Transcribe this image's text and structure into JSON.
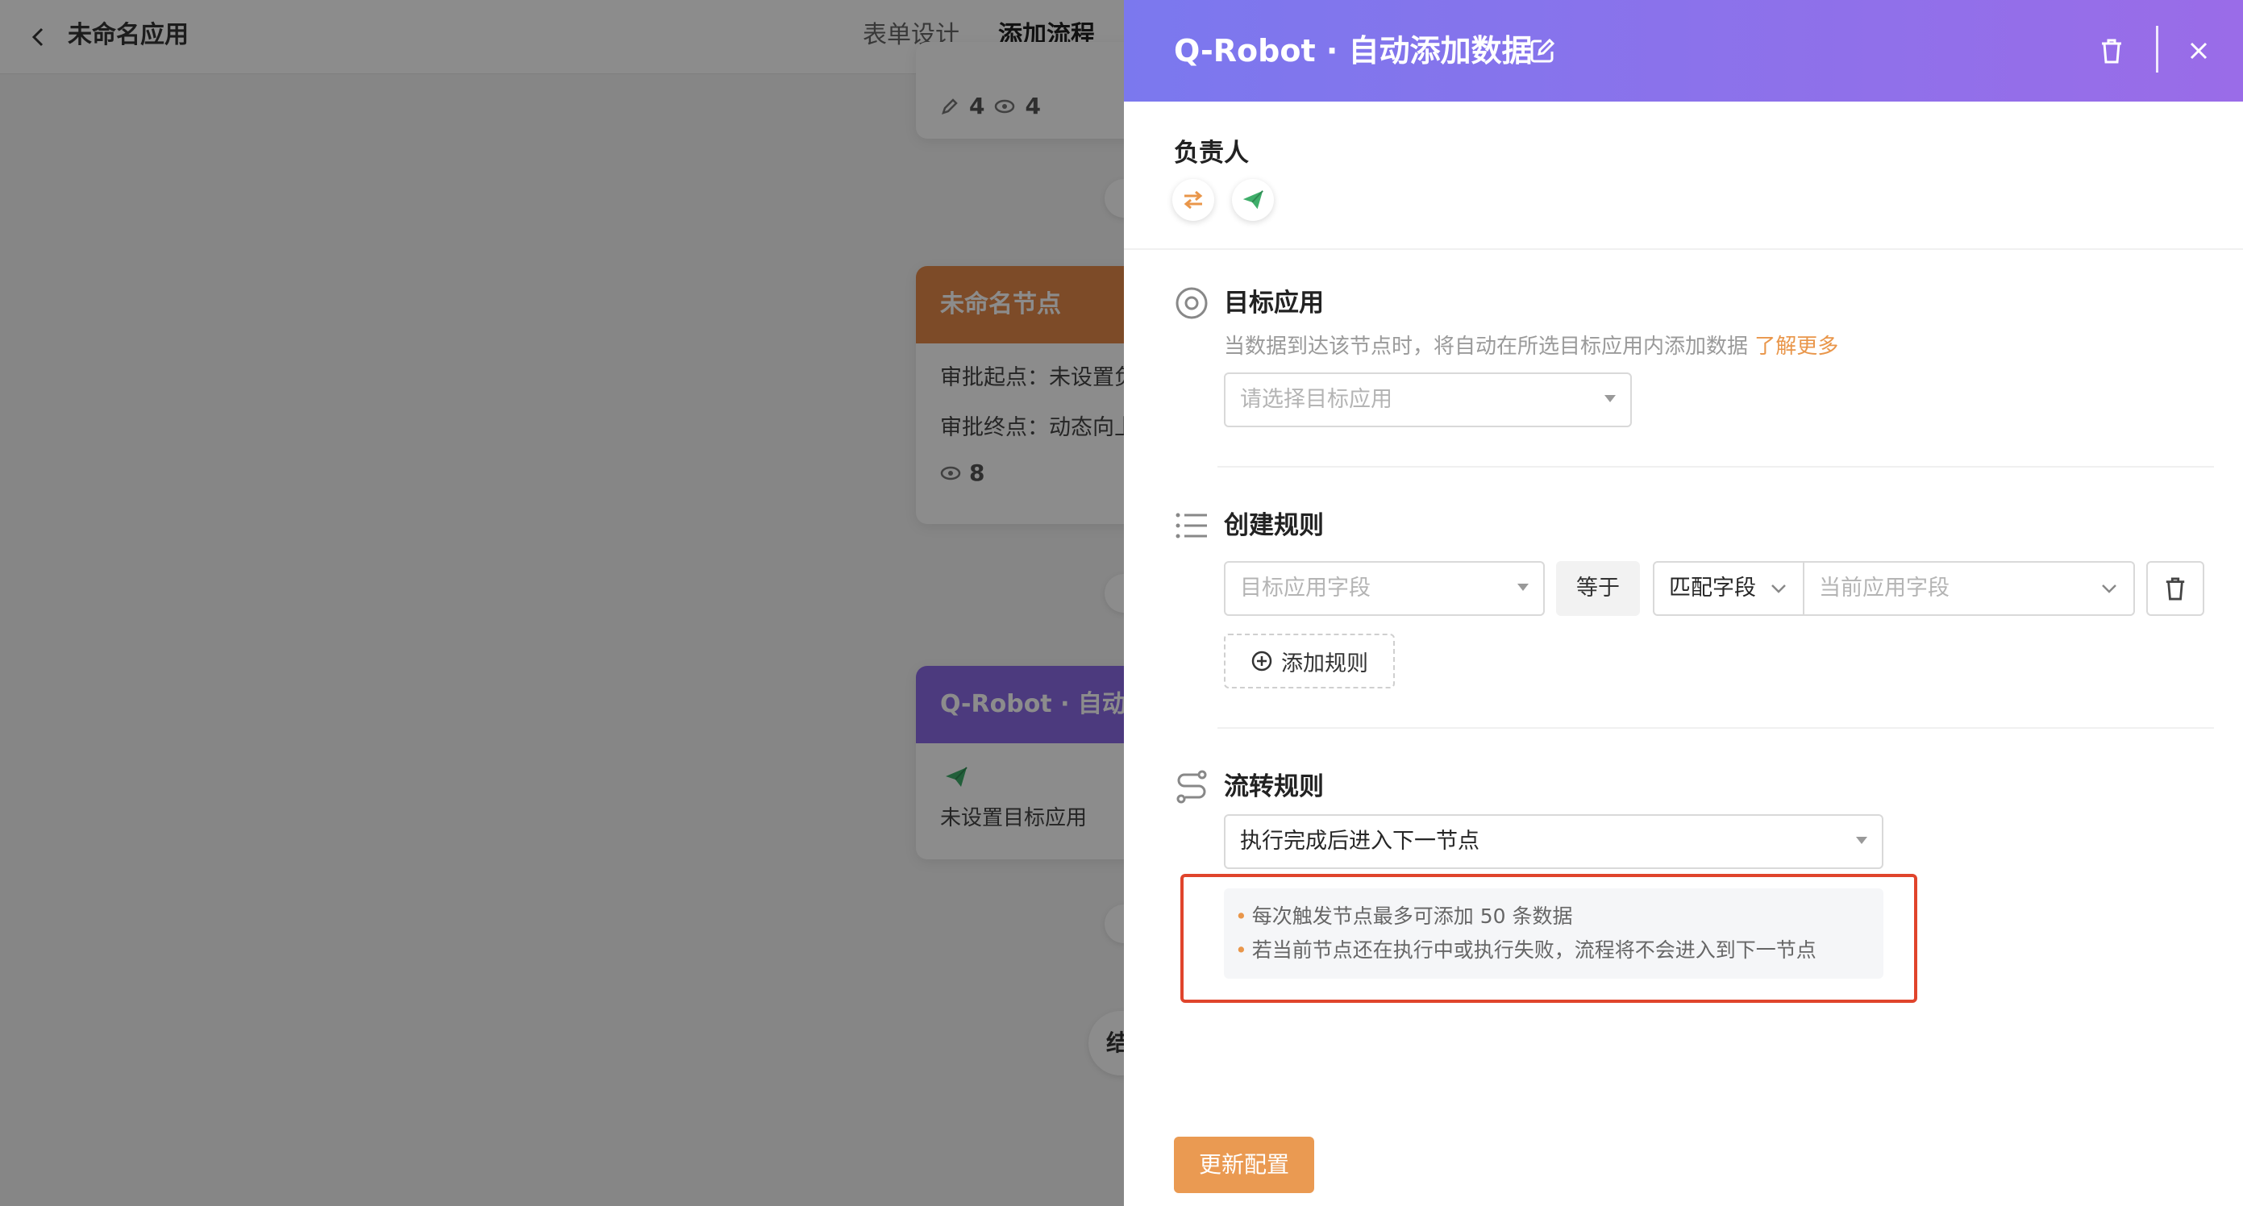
{
  "app": {
    "title": "未命名应用",
    "tabs": [
      {
        "label": "表单设计",
        "active": false
      },
      {
        "label": "添加流程",
        "active": true
      }
    ]
  },
  "canvas": {
    "stats_card": {
      "edit_count": "4",
      "view_count": "4"
    },
    "orange_node": {
      "title": "未命名节点",
      "line1": "审批起点：未设置负",
      "line2": "审批终点：动态向上",
      "view_count": "8",
      "color": "#e3894a"
    },
    "robot_node": {
      "title": "Q-Robot · 自动添加数据",
      "status": "未设置目标应用",
      "color": "#8a6ae6"
    },
    "end_node": {
      "label": "结束"
    }
  },
  "drawer": {
    "title": "Q-Robot · 自动添加数据",
    "owner": {
      "label": "负责人"
    },
    "target_app": {
      "title": "目标应用",
      "description": "当数据到达该节点时，将自动在所选目标应用内添加数据",
      "learn_more": "了解更多",
      "select_placeholder": "请选择目标应用"
    },
    "create_rule": {
      "title": "创建规则",
      "target_field_placeholder": "目标应用字段",
      "operator": "等于",
      "match_type": "匹配字段",
      "current_field_placeholder": "当前应用字段",
      "add_rule_label": "添加规则"
    },
    "flow_rule": {
      "title": "流转规则",
      "selected": "执行完成后进入下一节点",
      "notes": [
        "每次触发节点最多可添加 50 条数据",
        "若当前节点还在执行中或执行失败，流程将不会进入到下一节点"
      ]
    },
    "update_button": "更新配置"
  },
  "colors": {
    "accent": "#e9964a",
    "header_gradient_start": "#7b78ee",
    "header_gradient_end": "#9a6ce8",
    "highlight": "#e0442c"
  }
}
